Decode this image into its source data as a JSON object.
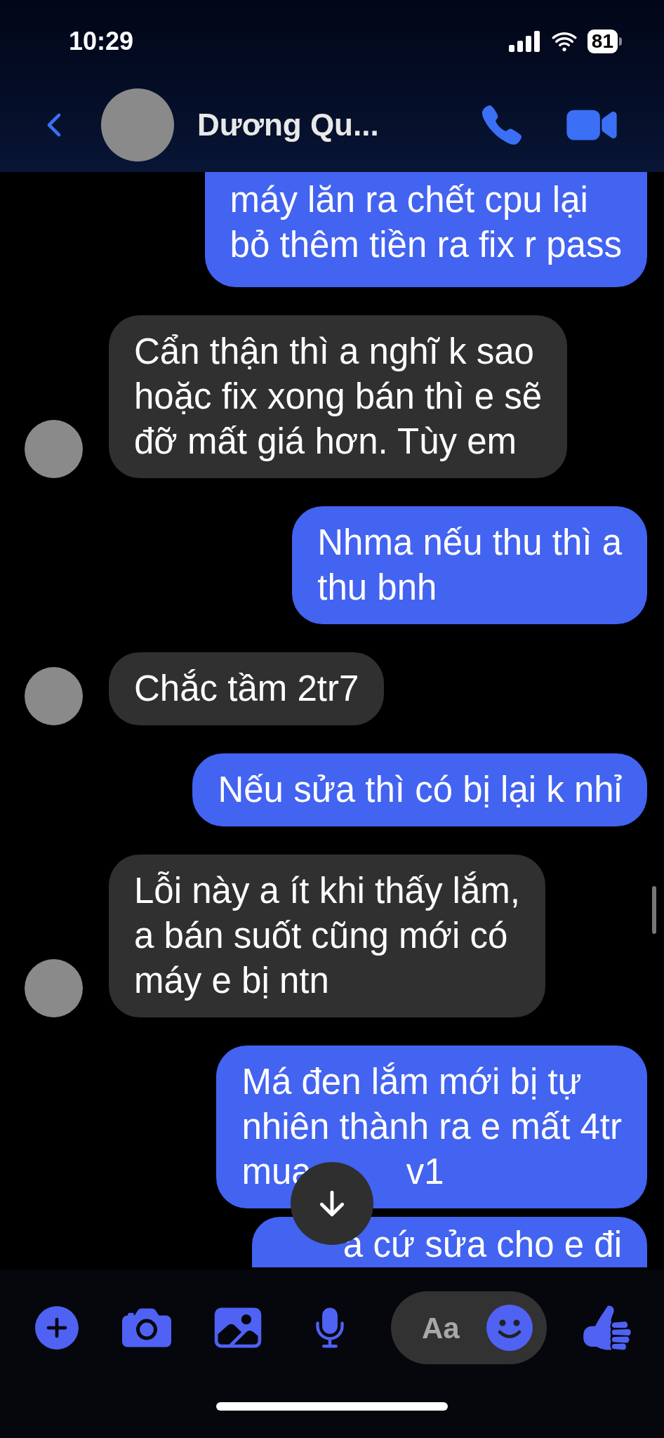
{
  "status_bar": {
    "time": "10:29",
    "battery": "81"
  },
  "header": {
    "name": "Dương Qu..."
  },
  "messages": [
    {
      "kind": "sent",
      "clipped_top": true,
      "lines": [
        "máy lăn ra chết cpu lại",
        "bỏ thêm tiền ra fix r pass"
      ]
    },
    {
      "kind": "received",
      "clipped_top": false,
      "lines": [
        "Cẩn thận thì a nghĩ k sao",
        "hoặc fix xong bán thì e sẽ",
        "đỡ mất giá hơn. Tùy em"
      ]
    },
    {
      "kind": "sent",
      "clipped_top": false,
      "lines": [
        "Nhma nếu thu thì a",
        "thu bnh"
      ]
    },
    {
      "kind": "received",
      "clipped_top": false,
      "lines": [
        "Chắc tầm 2tr7"
      ]
    },
    {
      "kind": "sent",
      "clipped_top": false,
      "lines": [
        "Nếu sửa thì có bị lại k nhỉ"
      ]
    },
    {
      "kind": "received",
      "clipped_top": false,
      "lines": [
        "Lỗi này a ít khi thấy lắm,",
        "a bán suốt cũng mới có",
        "máy e bị ntn"
      ]
    },
    {
      "kind": "sent",
      "clipped_top": false,
      "lines": [
        "Má đen lắm mới bị tự",
        "nhiên thành ra e mất 4tr"
      ],
      "covered_line": [
        "mua",
        "v1"
      ]
    },
    {
      "kind": "sent",
      "clipped_top": false,
      "clipped_bottom": true,
      "lines": [
        "a cứ sửa cho e đi"
      ]
    }
  ],
  "composer": {
    "placeholder": "Aa"
  }
}
